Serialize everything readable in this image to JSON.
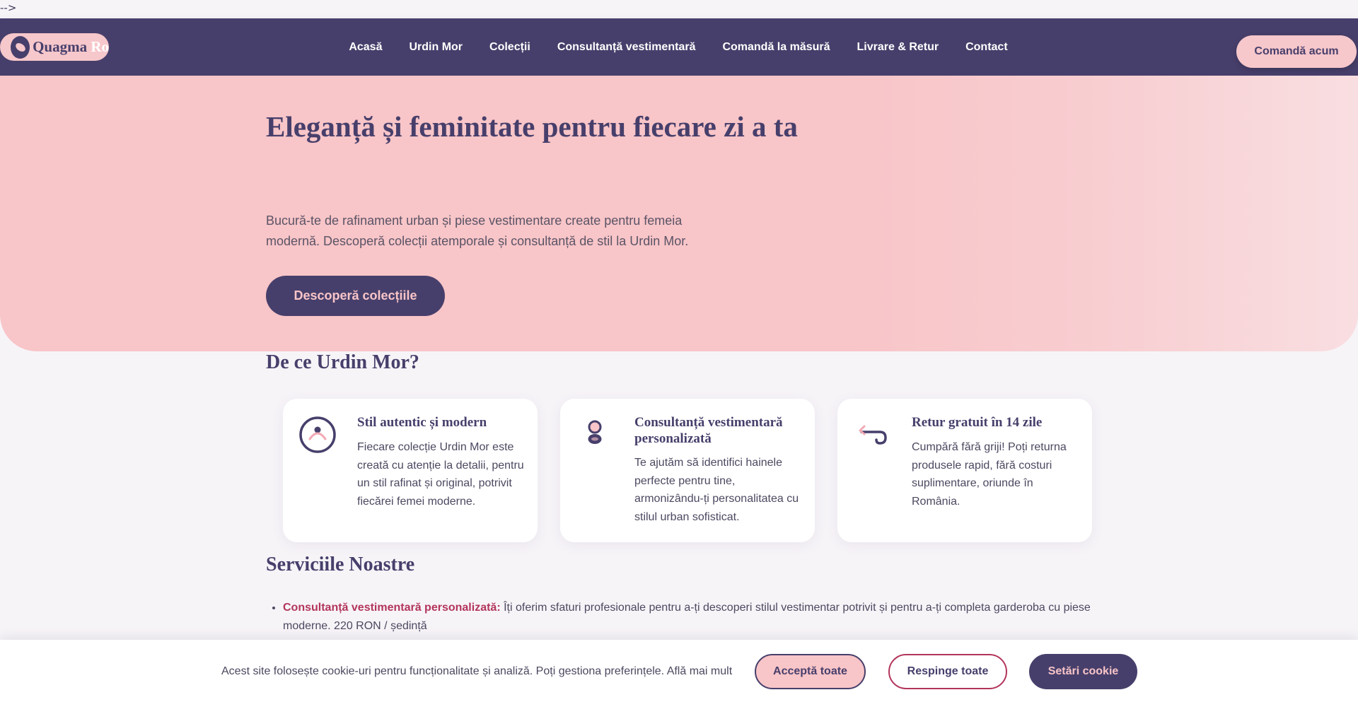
{
  "stray_text": "-->",
  "header": {
    "logo_text_main": "Quagma ",
    "logo_text_faded": "Ro",
    "nav": [
      "Acasă",
      "Urdin Mor",
      "Colecții",
      "Consultanță vestimentară",
      "Comandă la măsură",
      "Livrare & Retur",
      "Contact"
    ],
    "cta_label": "Comandă acum"
  },
  "hero": {
    "title": "Eleganță și feminitate pentru fiecare zi a ta",
    "subtitle": "Bucură-te de rafinament urban și piese vestimentare create pentru femeia modernă. Descoperă colecții atemporale și consultanță de stil la Urdin Mor.",
    "button_label": "Descoperă colecțiile"
  },
  "why": {
    "title": "De ce Urdin Mor?",
    "cards": [
      {
        "icon": "dress-circle-icon",
        "title": "Stil autentic și modern",
        "text": "Fiecare colecție Urdin Mor este creată cu atenție la detalii, pentru un stil rafinat și original, potrivit fiecărei femei moderne."
      },
      {
        "icon": "stylist-person-icon",
        "title": "Consultanță vestimentară personalizată",
        "text": "Te ajutăm să identifici hainele perfecte pentru tine, armonizându-ți personalitatea cu stilul urban sofisticat."
      },
      {
        "icon": "return-arrow-icon",
        "title": "Retur gratuit în 14 zile",
        "text": "Cumpără fără griji! Poți returna produsele rapid, fără costuri suplimentare, oriunde în România."
      }
    ]
  },
  "services": {
    "title": "Serviciile Noastre",
    "items": [
      {
        "name": "Consultanță vestimentară personalizată:",
        "text": " Îți oferim sfaturi profesionale pentru a-ți descoperi stilul vestimentar potrivit și pentru a-ți completa garderoba cu piese moderne. 220 RON / ședință"
      }
    ]
  },
  "cookie": {
    "text": "Acest site folosește cookie-uri pentru funcționalitate și analiză. Poți gestiona preferințele. Află mai mult",
    "accept_label": "Acceptă toate",
    "reject_label": "Respinge toate",
    "settings_label": "Setări cookie"
  },
  "colors": {
    "primary": "#473f6b",
    "pink": "#f8c5c8",
    "accent": "#b3355b",
    "background": "#f7f4f8"
  }
}
